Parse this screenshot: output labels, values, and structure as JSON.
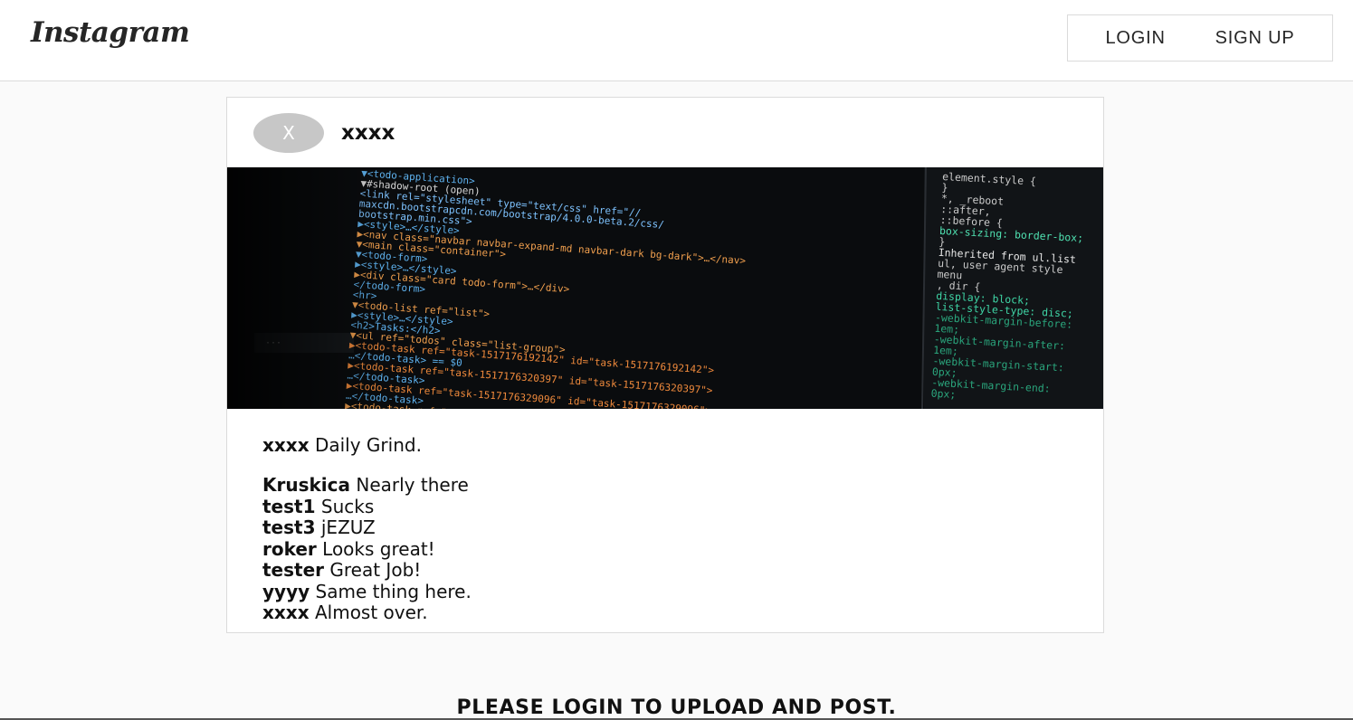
{
  "header": {
    "logo": "Instagram",
    "login_label": "LOGIN",
    "signup_label": "SIGN UP"
  },
  "post": {
    "avatar_initial": "X",
    "username": "xxxx",
    "caption": {
      "username": "xxxx",
      "text": "Daily Grind."
    },
    "comments": [
      {
        "username": "Kruskica",
        "text": "Nearly there"
      },
      {
        "username": "test1",
        "text": "Sucks"
      },
      {
        "username": "test3",
        "text": "jEZUZ"
      },
      {
        "username": "roker",
        "text": "Looks great!"
      },
      {
        "username": "tester",
        "text": "Great Job!"
      },
      {
        "username": "yyyy",
        "text": "Same thing here."
      },
      {
        "username": "xxxx",
        "text": "Almost over."
      }
    ],
    "image_code_left": [
      "▼<todo-application>",
      " ▼#shadow-root (open)",
      "   <link rel=\"stylesheet\" type=\"text/css\" href=\"//",
      "   maxcdn.bootstrapcdn.com/bootstrap/4.0.0-beta.2/css/",
      "   bootstrap.min.css\">",
      "  ▶<style>…</style>",
      "  ▶<nav class=\"navbar navbar-expand-md navbar-dark bg-dark\">…</nav>",
      "  ▼<main class=\"container\">",
      "   ▼<todo-form>",
      "    ▶<style>…</style>",
      "    ▶<div class=\"card todo-form\">…</div>",
      "    </todo-form>",
      "    <hr>",
      "  ▼<todo-list ref=\"list\">",
      "   ▶<style>…</style>",
      "    <h2>Tasks:</h2>",
      "   ▼<ul ref=\"todos\" class=\"list-group\">",
      "    ▶<todo-task ref=\"task-1517176192142\" id=\"task-1517176192142\">",
      "    …</todo-task> == $0",
      "    ▶<todo-task ref=\"task-1517176320397\" id=\"task-1517176320397\">",
      "    …</todo-task>",
      "    ▶<todo-task ref=\"task-1517176329096\" id=\"task-1517176329096\">",
      "    …</todo-task>",
      "    ▶<todo-task ref=\"task-…"
    ],
    "image_code_right": [
      "element.style {",
      "}",
      "*,              _reboot",
      "::after,",
      "::before {",
      "  box-sizing: border-box;",
      "}",
      "Inherited from ul.list",
      "ul,   user agent style",
      "menu",
      ", dir {",
      "  display: block;",
      "  list-style-type: disc;",
      "  -webkit-margin-before:",
      "    1em;",
      "  -webkit-margin-after:",
      "    1em;",
      "  -webkit-margin-start:",
      "    0px;",
      "  -webkit-margin-end:",
      "    0px;"
    ]
  },
  "footer": {
    "message": "PLEASE LOGIN TO UPLOAD AND POST."
  },
  "colors": {
    "background": "#fafafa",
    "card": "#ffffff",
    "border": "#dbdbdb",
    "avatar": "#c7c7c7",
    "code_bg": "#0a0c0e"
  }
}
